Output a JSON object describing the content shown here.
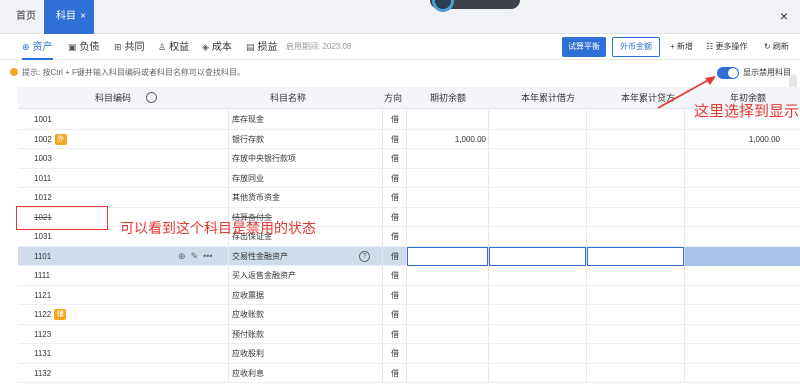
{
  "tabs": {
    "home": "首页",
    "active": "科目",
    "close": "×"
  },
  "window": {
    "close": "×"
  },
  "category_tabs": [
    {
      "label": "资产",
      "icon": "asset-icon",
      "glyph": "⊕"
    },
    {
      "label": "负债",
      "icon": "liability-icon",
      "glyph": "▣"
    },
    {
      "label": "共同",
      "icon": "common-icon",
      "glyph": "⊞"
    },
    {
      "label": "权益",
      "icon": "equity-icon",
      "glyph": "♙"
    },
    {
      "label": "成本",
      "icon": "cost-icon",
      "glyph": "◈"
    },
    {
      "label": "损益",
      "icon": "profit-loss-icon",
      "glyph": "▤"
    }
  ],
  "period": "启用期间: 2023.08",
  "actions": {
    "trial_balance": "试算平衡",
    "foreign_currency": "外币金额",
    "add": "+ 新增",
    "more": "☷ 更多操作",
    "refresh": "↻ 刷新"
  },
  "tip": {
    "text": "提示: 按Ctrl + F键并输入科目编码或者科目名称可以查找科目。",
    "toggle_label": "显示禁用科目",
    "toggle_on": true
  },
  "columns": [
    "科目编码",
    "科目名称",
    "方向",
    "期初余额",
    "本年累计借方",
    "本年累计贷方",
    "年初余额"
  ],
  "rows": [
    {
      "code": "1001",
      "name": "库存现金",
      "dir": "借",
      "opening": "",
      "year_open": ""
    },
    {
      "code": "1002",
      "badge": "外",
      "name": "银行存款",
      "dir": "借",
      "opening": "1,000.00",
      "year_open": "1,000.00"
    },
    {
      "code": "1003",
      "name": "存放中央银行款项",
      "dir": "借",
      "opening": "",
      "year_open": ""
    },
    {
      "code": "1011",
      "name": "存放同业",
      "dir": "借",
      "opening": "",
      "year_open": ""
    },
    {
      "code": "1012",
      "name": "其他货币资金",
      "dir": "借",
      "opening": "",
      "year_open": ""
    },
    {
      "code": "1021",
      "name": "结算备付金",
      "dir": "借",
      "opening": "",
      "year_open": "",
      "disabled": true
    },
    {
      "code": "1031",
      "name": "存出保证金",
      "dir": "借",
      "opening": "",
      "year_open": ""
    },
    {
      "code": "1101",
      "name": "交易性金融资产",
      "dir": "借",
      "opening": "",
      "year_open": "",
      "selected": true
    },
    {
      "code": "1111",
      "name": "买入返售金融资产",
      "dir": "借",
      "opening": "",
      "year_open": ""
    },
    {
      "code": "1121",
      "name": "应收票据",
      "dir": "借",
      "opening": "",
      "year_open": ""
    },
    {
      "code": "1122",
      "badge": "辅",
      "name": "应收账款",
      "dir": "借",
      "opening": "",
      "year_open": ""
    },
    {
      "code": "1123",
      "name": "预付账款",
      "dir": "借",
      "opening": "",
      "year_open": ""
    },
    {
      "code": "1131",
      "name": "应收股利",
      "dir": "借",
      "opening": "",
      "year_open": ""
    },
    {
      "code": "1132",
      "name": "应收利息",
      "dir": "借",
      "opening": "",
      "year_open": ""
    }
  ],
  "row_actions": {
    "add": "⊕",
    "edit": "✎",
    "more": "•••",
    "help": "?"
  },
  "annotations": {
    "disabled_hint": "可以看到这个科目是禁用的状态",
    "toggle_hint": "这里选择到显示"
  },
  "colors": {
    "primary": "#2f6fd6",
    "annotation": "#e53935",
    "badge": "#f5a623"
  }
}
